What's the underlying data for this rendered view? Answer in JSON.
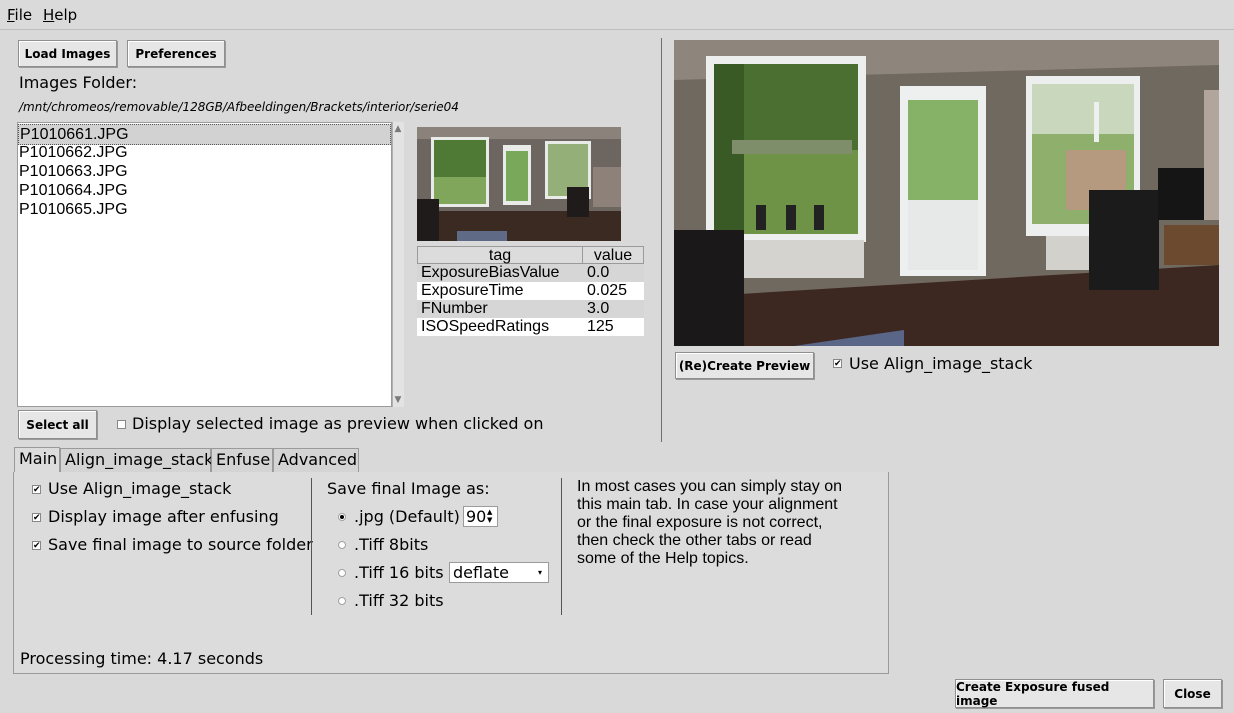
{
  "menu": {
    "file": "File",
    "file_accel": "F",
    "file_rest": "ile",
    "help": "Help",
    "help_accel": "H",
    "help_rest": "elp"
  },
  "toolbar": {
    "load_images": "Load Images",
    "preferences": "Preferences"
  },
  "folder": {
    "label": "Images Folder:",
    "path": "/mnt/chromeos/removable/128GB/Afbeeldingen/Brackets/interior/serie04"
  },
  "files": [
    "P1010661.JPG",
    "P1010662.JPG",
    "P1010663.JPG",
    "P1010664.JPG",
    "P1010665.JPG"
  ],
  "selected_file_index": 0,
  "exif": {
    "headers": {
      "tag": "tag",
      "value": "value"
    },
    "rows": [
      {
        "tag": "ExposureBiasValue",
        "value": "0.0"
      },
      {
        "tag": "ExposureTime",
        "value": "0.025"
      },
      {
        "tag": "FNumber",
        "value": "3.0"
      },
      {
        "tag": "ISOSpeedRatings",
        "value": "125"
      }
    ]
  },
  "select_all": "Select all",
  "display_selected_preview": {
    "label": "Display selected image as preview when clicked on",
    "checked": false
  },
  "preview": {
    "recreate_button": "(Re)Create Preview",
    "use_align_label": "Use Align_image_stack",
    "use_align_checked": true
  },
  "tabs": [
    "Main",
    "Align_image_stack",
    "Enfuse",
    "Advanced"
  ],
  "active_tab": "Main",
  "main_tab": {
    "options": [
      {
        "label": "Use Align_image_stack",
        "checked": true
      },
      {
        "label": "Display image after enfusing",
        "checked": true
      },
      {
        "label": "Save final image to source folder",
        "checked": true
      }
    ],
    "save_as_label": "Save final Image as:",
    "formats": [
      {
        "label": ".jpg (Default)",
        "selected": true
      },
      {
        "label": ".Tiff 8bits",
        "selected": false
      },
      {
        "label": ".Tiff 16 bits",
        "selected": false
      },
      {
        "label": ".Tiff 32 bits",
        "selected": false
      }
    ],
    "jpg_quality": "90",
    "tiff16_compression": "deflate",
    "help_text": [
      "In most cases you can simply stay on",
      "this main tab. In case your alignment",
      "or the final exposure is not correct,",
      "then check the other tabs or read",
      "some of the Help topics."
    ],
    "processing_time": "Processing time: 4.17 seconds"
  },
  "footer": {
    "create_button": "Create Exposure fused image",
    "close_button": "Close"
  },
  "colors": {
    "background": "#d9d9d9",
    "list_background": "#ffffff",
    "selection": "#d2d2d2"
  }
}
